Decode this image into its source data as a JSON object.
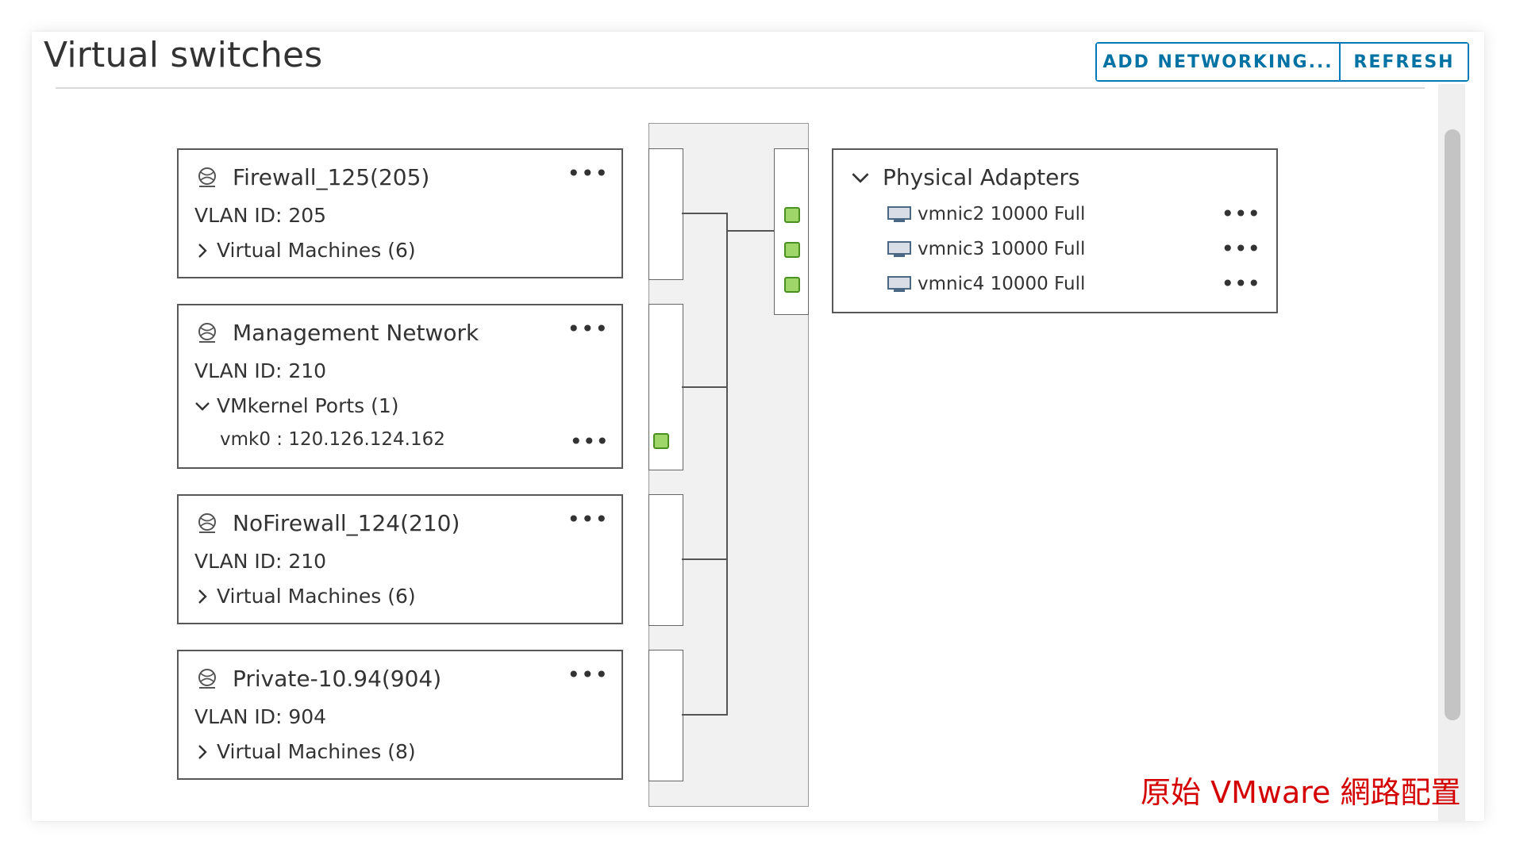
{
  "page": {
    "title": "Virtual switches",
    "buttons": {
      "add_networking": "ADD NETWORKING...",
      "refresh": "REFRESH"
    },
    "caption": "原始 VMware 網路配置"
  },
  "port_groups": [
    {
      "name": "Firewall_125(205)",
      "vlan": "VLAN ID: 205",
      "expander": "Virtual Machines (6)",
      "expanded": false,
      "more": "•••"
    },
    {
      "name": "Management Network",
      "vlan": "VLAN ID: 210",
      "expander": "VMkernel Ports (1)",
      "expanded": true,
      "more": "•••",
      "vmk": {
        "label": "vmk0 : 120.126.124.162",
        "more": "•••"
      }
    },
    {
      "name": "NoFirewall_124(210)",
      "vlan": "VLAN ID: 210",
      "expander": "Virtual Machines (6)",
      "expanded": false,
      "more": "•••"
    },
    {
      "name": "Private-10.94(904)",
      "vlan": "VLAN ID: 904",
      "expander": "Virtual Machines (8)",
      "expanded": false,
      "more": "•••"
    }
  ],
  "physical_adapters": {
    "title": "Physical Adapters",
    "expanded": true,
    "items": [
      {
        "label": "vmnic2 10000 Full",
        "more": "•••"
      },
      {
        "label": "vmnic3 10000 Full",
        "more": "•••"
      },
      {
        "label": "vmnic4 10000 Full",
        "more": "•••"
      }
    ]
  },
  "icons": {
    "port_group": "network-globe-icon",
    "nic": "network-adapter-icon",
    "chevron_right": "chevron-right-icon",
    "chevron_down": "chevron-down-icon",
    "port": "port-icon"
  },
  "colors": {
    "accent": "#0079b8",
    "port_fill": "#9ed66a",
    "port_border": "#4a8f1f",
    "caption": "#d40000"
  }
}
